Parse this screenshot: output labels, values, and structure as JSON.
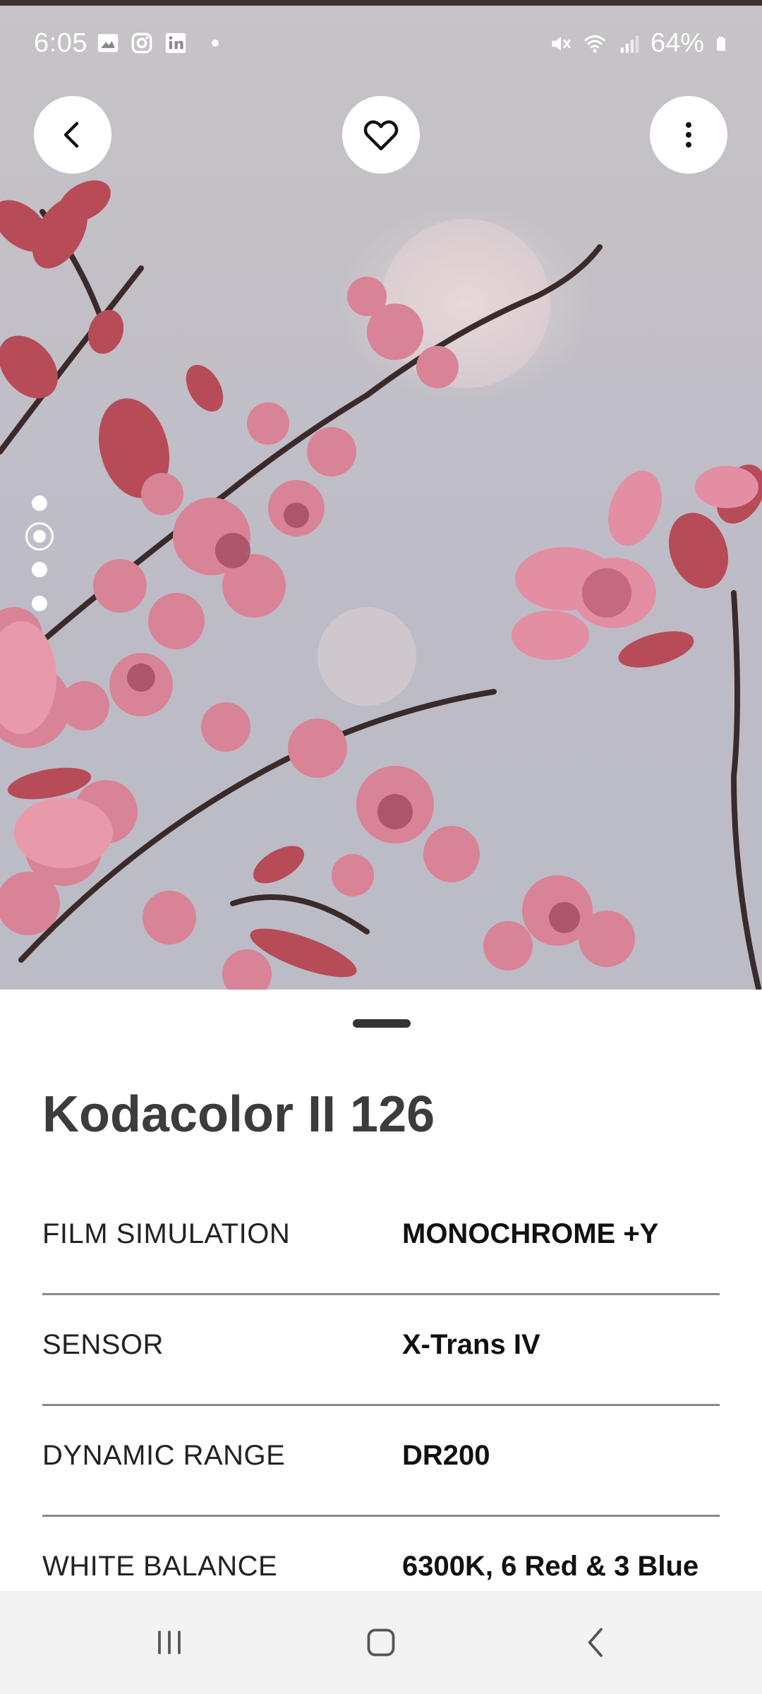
{
  "status_bar": {
    "time": "6:05",
    "battery": "64%",
    "icons_left": [
      "gallery-icon",
      "instagram-icon",
      "linkedin-icon",
      "notification-dot"
    ],
    "icons_right": [
      "mute-icon",
      "wifi-icon",
      "signal-icon",
      "battery-icon"
    ]
  },
  "toolbar": {
    "back_icon": "chevron-left-icon",
    "favorite_icon": "heart-outline-icon",
    "more_icon": "more-vertical-icon"
  },
  "gallery": {
    "page_count": 4,
    "current_page": 2
  },
  "sheet": {
    "title": "Kodacolor II 126",
    "specs": [
      {
        "label": "FILM SIMULATION",
        "value": "MONOCHROME +Y"
      },
      {
        "label": "SENSOR",
        "value": "X-Trans IV"
      },
      {
        "label": "DYNAMIC RANGE",
        "value": "DR200"
      },
      {
        "label": "WHITE BALANCE",
        "value": "6300K, 6 Red & 3 Blue"
      }
    ]
  },
  "nav_bar": {
    "recents_icon": "recent-apps-icon",
    "home_icon": "home-icon",
    "back_icon": "back-icon"
  },
  "colors": {
    "title": "#3c3c3c",
    "sky": "#c2bfc6",
    "blossom": "#d97a8e",
    "leaf": "#b04a55",
    "navbar": "#f3f3f3"
  }
}
